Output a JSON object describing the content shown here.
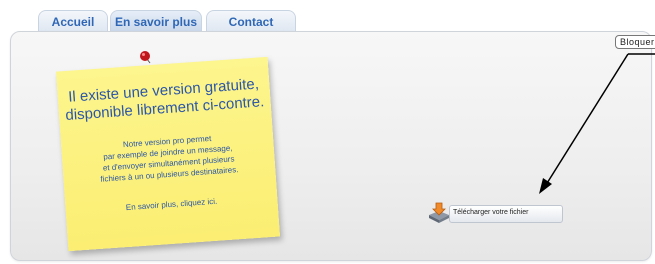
{
  "nav": {
    "tabs": [
      {
        "label": "Accueil"
      },
      {
        "label": "En savoir plus"
      },
      {
        "label": "Contact"
      }
    ]
  },
  "popup_block": {
    "label": "Bloquer"
  },
  "note": {
    "title_line1": "Il existe une version gratuite,",
    "title_line2": "disponible librement ci-contre.",
    "body_line1": "Notre version pro permet",
    "body_line2": "par exemple de joindre un message,",
    "body_line3": "et d'envoyer simultanément plusieurs",
    "body_line4": "fichiers à un ou plusieurs destinataires.",
    "more_link": "En savoir plus, cliquez ici."
  },
  "download": {
    "label": "Télécharger votre fichier"
  },
  "colors": {
    "tab_text": "#2f67b6",
    "note_text": "#2c57a8",
    "note_bg": "#fbee72",
    "pin": "#c0171d"
  },
  "icons": {
    "pin": "pushpin-icon",
    "download": "download-tray-icon",
    "arrow": "pointer-arrow-icon"
  }
}
